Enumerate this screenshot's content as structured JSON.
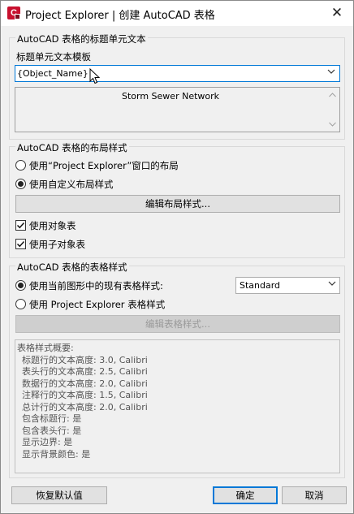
{
  "window": {
    "title": "Project Explorer | 创建 AutoCAD 表格",
    "app_icon_letter": "C",
    "close_glyph": "✕"
  },
  "title_group": {
    "legend": "AutoCAD 表格的标题单元文本",
    "template_label": "标题单元文本模板",
    "template_value": "{Object_Name}",
    "preview_text": "Storm Sewer Network"
  },
  "layout_group": {
    "legend": "AutoCAD 表格的布局样式",
    "option_project_layout": "使用“Project Explorer”窗口的布局",
    "option_custom_layout": "使用自定义布局样式",
    "selected_option": "option_custom_layout",
    "edit_button": "编辑布局样式...",
    "use_object_table": "使用对象表",
    "use_object_table_checked": true,
    "use_subobject_table": "使用子对象表",
    "use_subobject_table_checked": true
  },
  "table_style_group": {
    "legend": "AutoCAD 表格的表格样式",
    "option_current_drawing": "使用当前图形中的现有表格样式:",
    "option_project_explorer": "使用 Project Explorer 表格样式",
    "selected_option": "option_current_drawing",
    "style_dropdown_value": "Standard",
    "edit_button": "编辑表格样式...",
    "edit_button_enabled": false,
    "summary_lines": [
      "表格样式概要:",
      "  标题行的文本高度: 3.0, Calibri",
      "  表头行的文本高度: 2.5, Calibri",
      "  数据行的文本高度: 2.0, Calibri",
      "  注释行的文本高度: 1.5, Calibri",
      "  总计行的文本高度: 2.0, Calibri",
      "  包含标题行: 是",
      "  包含表头行: 是",
      "  显示边界: 是",
      "  显示背景颜色: 是"
    ]
  },
  "footer": {
    "restore_defaults": "恢复默认值",
    "ok": "确定",
    "cancel": "取消"
  },
  "colors": {
    "accent": "#0078d7",
    "app_icon": "#c8102e",
    "dialog_bg": "#f0f0f0"
  }
}
